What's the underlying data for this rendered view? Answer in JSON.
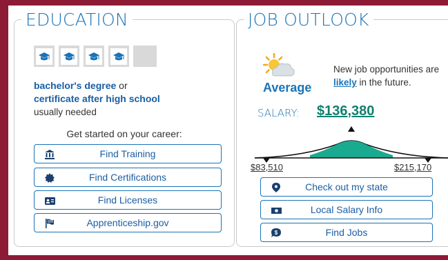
{
  "education": {
    "title": "EDUCATION",
    "education_level_filled": 4,
    "education_level_total": 5,
    "degree_line1": "bachelor's degree",
    "degree_or": " or",
    "degree_line2": "certificate after high school",
    "needed": "usually needed",
    "get_started": "Get started on your career:",
    "buttons": [
      {
        "label": "Find Training",
        "icon": "bank-icon"
      },
      {
        "label": "Find Certifications",
        "icon": "badge-icon"
      },
      {
        "label": "Find Licenses",
        "icon": "id-card-icon"
      },
      {
        "label": "Apprenticeship.gov",
        "icon": "flag-icon"
      }
    ]
  },
  "job_outlook": {
    "title": "JOB OUTLOOK",
    "outlook": "Average",
    "outlook_icon": "partly-cloudy-icon",
    "desc_before": "New job opportunities are ",
    "desc_likely": "likely",
    "desc_after": " in the future.",
    "salary_label": "SALARY:",
    "salary_median": "$136,380",
    "salary_low": "$83,510",
    "salary_high": "$215,170",
    "buttons": [
      {
        "label": "Check out my state",
        "icon": "map-pin-icon"
      },
      {
        "label": "Local Salary Info",
        "icon": "money-icon"
      },
      {
        "label": "Find Jobs",
        "icon": "dollar-bubble-icon"
      }
    ]
  },
  "colors": {
    "brand_border": "#8e1b36",
    "heading_blue": "#1a73b7",
    "salary_green": "#117f6f",
    "curve_fill": "#1aaa8f"
  }
}
